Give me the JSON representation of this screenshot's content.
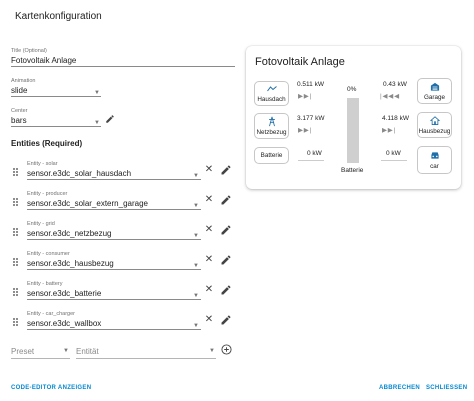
{
  "dialog": {
    "title": "Kartenkonfiguration"
  },
  "form": {
    "title": {
      "label": "Title (Optional)",
      "value": "Fotovoltaik Anlage"
    },
    "animation": {
      "label": "Animation",
      "value": "slide"
    },
    "center": {
      "label": "Center",
      "value": "bars"
    },
    "entities_heading": "Entities (Required)",
    "entities": [
      {
        "label": "Entity - solar",
        "value": "sensor.e3dc_solar_hausdach"
      },
      {
        "label": "Entity - producer",
        "value": "sensor.e3dc_solar_extern_garage"
      },
      {
        "label": "Entity - grid",
        "value": "sensor.e3dc_netzbezug"
      },
      {
        "label": "Entity - consumer",
        "value": "sensor.e3dc_hausbezug"
      },
      {
        "label": "Entity - battery",
        "value": "sensor.e3dc_batterie"
      },
      {
        "label": "Entity - car_charger",
        "value": "sensor.e3dc_wallbox"
      }
    ],
    "preset_placeholder": "Preset",
    "entity_placeholder": "Entität"
  },
  "preview": {
    "title": "Fotovoltaik Anlage",
    "nodes": {
      "hausdach": "Hausdach",
      "netzbezug": "Netzbezug",
      "batterie": "Batterie",
      "garage": "Garage",
      "hausbezug": "Hausbezug",
      "car": "car"
    },
    "values": {
      "hausdach": "0.511 kW",
      "netzbezug": "3.177 kW",
      "batterie": "0 kW",
      "garage": "0.43 kW",
      "hausbezug": "4.118 kW",
      "car": "0 kW"
    },
    "battery_percent": "0%",
    "battery_label": "Batterie",
    "battery_level": 0
  },
  "footer": {
    "code_editor": "CODE-EDITOR ANZEIGEN",
    "cancel": "ABBRECHEN",
    "close": "SCHLIESSEN"
  },
  "colors": {
    "accent": "#0288d1",
    "icon": "#1e6fa8"
  }
}
